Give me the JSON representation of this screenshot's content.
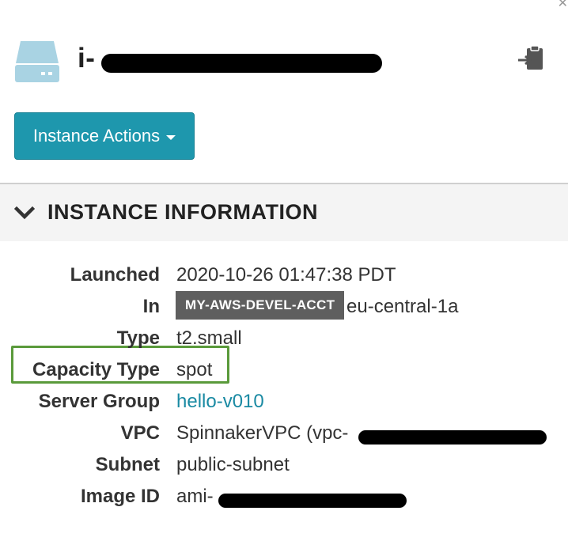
{
  "header": {
    "instance_id": "i-",
    "icons": {
      "server": "server-icon",
      "clipboard": "clipboard-copy-icon",
      "close": "close-icon"
    }
  },
  "toolbar": {
    "actions_label": "Instance Actions"
  },
  "section": {
    "title": "INSTANCE INFORMATION"
  },
  "info": {
    "launched_label": "Launched",
    "launched_value": "2020-10-26 01:47:38 PDT",
    "in_label": "In",
    "account": "MY-AWS-DEVEL-ACCT",
    "region": "eu-central-1a",
    "type_label": "Type",
    "type_value": "t2.small",
    "capacity_label": "Capacity Type",
    "capacity_value": "spot",
    "server_group_label": "Server Group",
    "server_group_value": "hello-v010",
    "vpc_label": "VPC",
    "vpc_value": "SpinnakerVPC (vpc-",
    "subnet_label": "Subnet",
    "subnet_value": "public-subnet",
    "image_label": "Image ID",
    "image_value": "ami-"
  },
  "colors": {
    "button": "#1e97ad",
    "link": "#1a8aa3",
    "badge": "#5f5f5f",
    "highlight": "#5a9a3b"
  }
}
